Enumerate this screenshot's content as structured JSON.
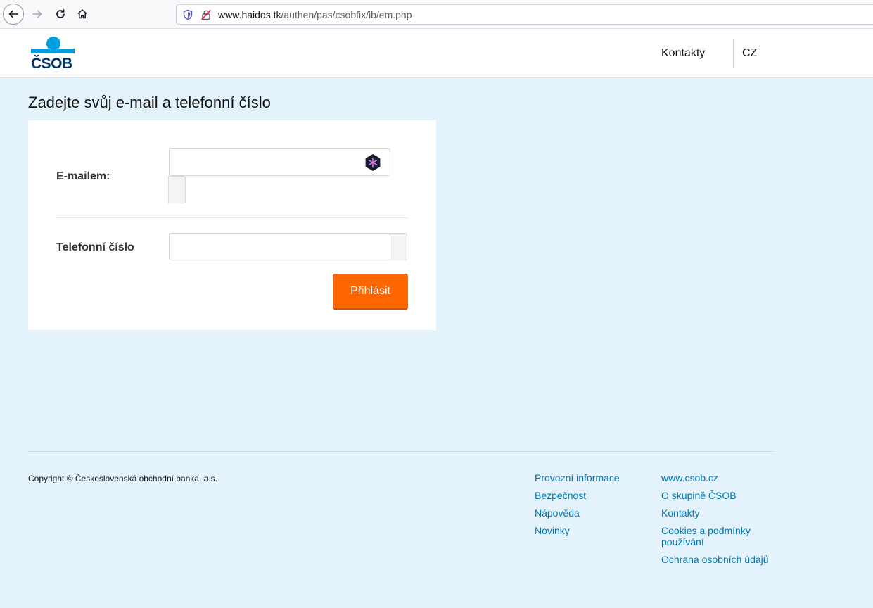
{
  "browser": {
    "url_host": "www.haidos.tk",
    "url_path": "/authen/pas/csobfix/ib/em.php"
  },
  "header": {
    "logo_text": "ČSOB",
    "contacts": "Kontakty",
    "language": "CZ"
  },
  "colors": {
    "accent_orange": "#ff6600",
    "brand_blue": "#009ee0",
    "brand_navy": "#003366",
    "link_blue": "#0077b3",
    "page_bg": "#e4f2fb"
  },
  "main": {
    "title": "Zadejte svůj e-mail a telefonní číslo",
    "email_label": "E-mailem:",
    "email_value": "",
    "phone_label": "Telefonní číslo",
    "phone_value": "",
    "submit_label": "Přihlásit"
  },
  "footer": {
    "copyright": "Copyright © Československá obchodní banka, a.s.",
    "col1": [
      "Provozní informace",
      "Bezpečnost",
      "Nápověda",
      "Novinky"
    ],
    "col2": [
      "www.csob.cz",
      "O skupině ČSOB",
      "Kontakty",
      "Cookies a podmínky používání",
      "Ochrana osobních údajů"
    ]
  }
}
